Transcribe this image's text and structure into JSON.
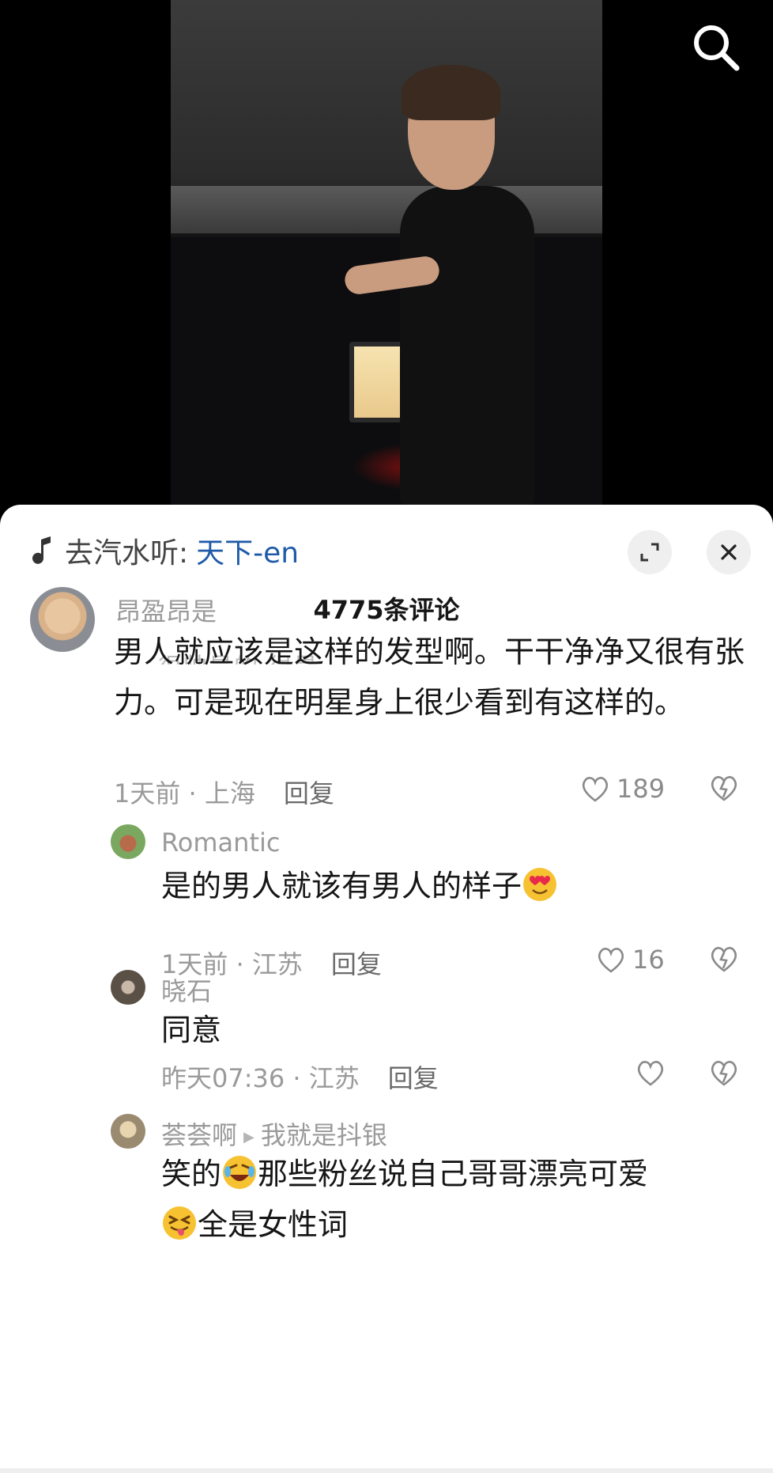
{
  "music": {
    "prefix": "去汽水听:",
    "song": "天下-en"
  },
  "comments_count_title": "4775条评论",
  "ghost_text": "很帅是的  很是",
  "comments": [
    {
      "username": "昂盈昂是",
      "text": "男人就应该是这样的发型啊。干干净净又很有张力。可是现在明星身上很少看到有这样的。",
      "time": "1天前 · 上海",
      "reply_label": "回复",
      "likes": "189"
    },
    {
      "username": "Romantic",
      "text": "是的男人就该有男人的样子",
      "emoji": "smiling-face-with-heart-eyes",
      "time": "1天前 · 江苏",
      "reply_label": "回复",
      "likes": "16"
    },
    {
      "username": "晓石",
      "text": "同意",
      "time": "昨天07:36 · 江苏",
      "reply_label": "回复",
      "likes": ""
    },
    {
      "username": "荟荟啊",
      "reply_to": "我就是抖银",
      "text_part1": "笑的",
      "text_part2": "那些粉丝说自己哥哥漂亮可爱",
      "text_part3": "全是女性词",
      "emoji1": "rolling-on-floor-laughing",
      "emoji2": "squinting-face-with-tongue"
    }
  ],
  "colors": {
    "link": "#1e5aa8",
    "meta": "#9a9a9a",
    "sheet_bg": "#ffffff"
  }
}
